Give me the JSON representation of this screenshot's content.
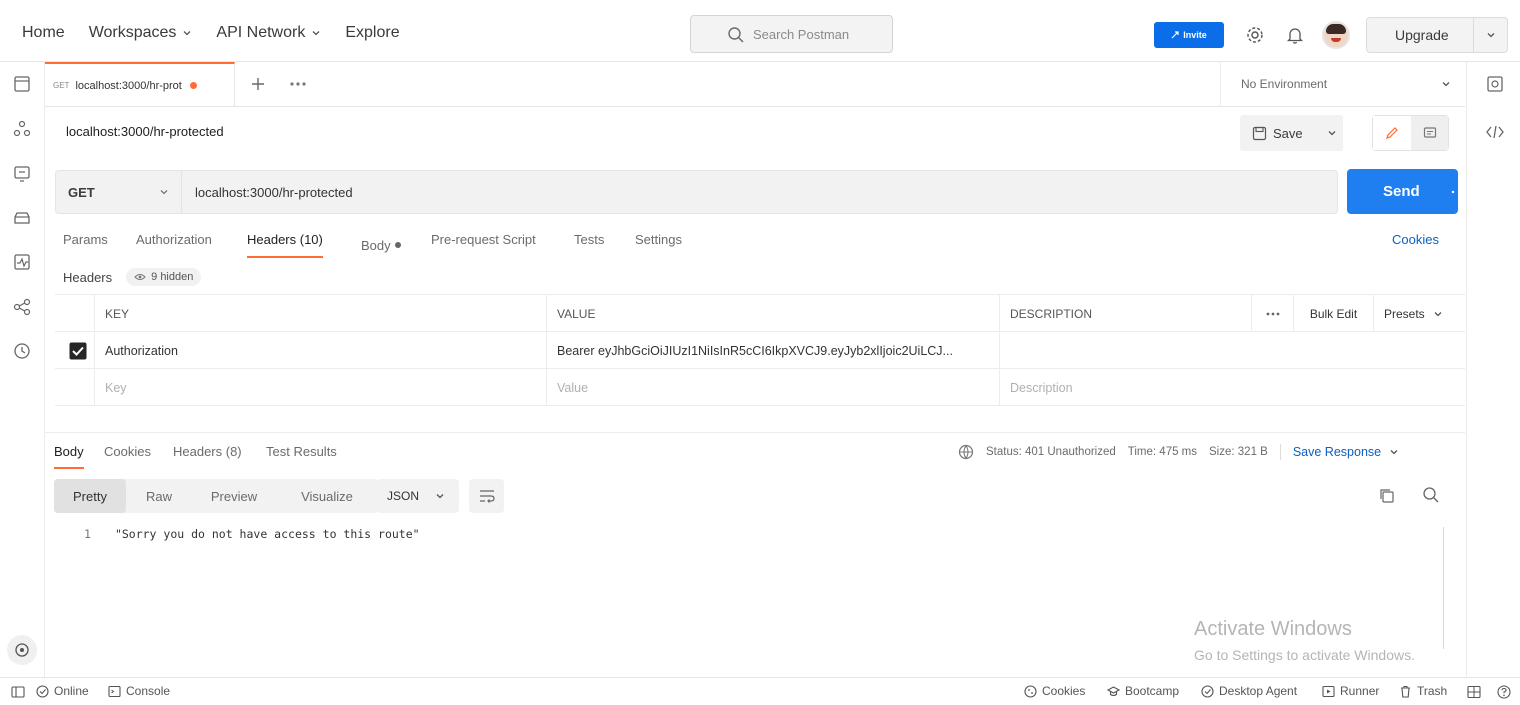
{
  "nav": {
    "home": "Home",
    "workspaces": "Workspaces",
    "api_network": "API Network",
    "explore": "Explore",
    "search_placeholder": "Search Postman",
    "invite": "Invite",
    "upgrade": "Upgrade"
  },
  "tab": {
    "method_badge": "GET",
    "title": "localhost:3000/hr-prot",
    "dirty_color": "#ff6c37"
  },
  "environment": "No Environment",
  "request": {
    "title": "localhost:3000/hr-protected",
    "save_label": "Save",
    "method": "GET",
    "url": "localhost:3000/hr-protected",
    "send_label": "Send"
  },
  "request_tabs": [
    "Params",
    "Authorization",
    "Headers (10)",
    "Body",
    "Pre-request Script",
    "Tests",
    "Settings"
  ],
  "cookies_link": "Cookies",
  "headers_section": {
    "label": "Headers",
    "hidden": "9 hidden",
    "columns": {
      "key": "KEY",
      "value": "VALUE",
      "description": "DESCRIPTION"
    },
    "bulk_edit": "Bulk Edit",
    "presets": "Presets",
    "rows": [
      {
        "key": "Authorization",
        "value": "Bearer eyJhbGciOiJIUzI1NiIsInR5cCI6IkpXVCJ9.eyJyb2xlIjoic2UiLCJ...",
        "description": ""
      }
    ],
    "placeholder": {
      "key": "Key",
      "value": "Value",
      "description": "Description"
    }
  },
  "response": {
    "tabs": [
      "Body",
      "Cookies",
      "Headers (8)",
      "Test Results"
    ],
    "status": "Status: 401 Unauthorized",
    "time": "Time: 475 ms",
    "size": "Size: 321 B",
    "save_response": "Save Response",
    "formats": [
      "Pretty",
      "Raw",
      "Preview",
      "Visualize"
    ],
    "language": "JSON",
    "lines": [
      {
        "n": "1",
        "text": "\"Sorry you do not have access to this route\""
      }
    ]
  },
  "watermark": {
    "title": "Activate Windows",
    "subtitle": "Go to Settings to activate Windows."
  },
  "statusbar": {
    "online": "Online",
    "console": "Console",
    "cookies": "Cookies",
    "bootcamp": "Bootcamp",
    "desktop_agent": "Desktop Agent",
    "runner": "Runner",
    "trash": "Trash"
  },
  "colors": {
    "accent": "#ff6c37",
    "primary": "#1f7ff0",
    "link": "#0b5fc4"
  }
}
